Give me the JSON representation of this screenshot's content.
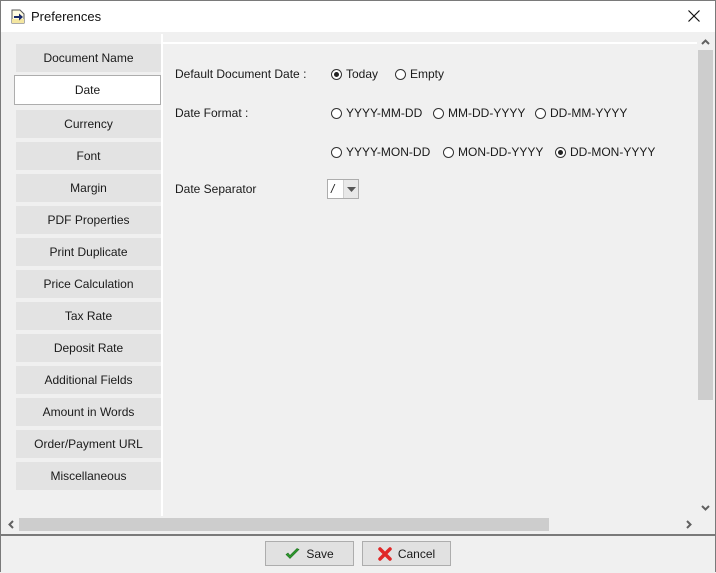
{
  "window": {
    "title": "Preferences",
    "icon": "preferences-app-icon",
    "close_icon": "close-icon"
  },
  "sidebar": {
    "items": [
      {
        "label": "Document Name",
        "active": false
      },
      {
        "label": "Date",
        "active": true
      },
      {
        "label": "Currency",
        "active": false
      },
      {
        "label": "Font",
        "active": false
      },
      {
        "label": "Margin",
        "active": false
      },
      {
        "label": "PDF Properties",
        "active": false
      },
      {
        "label": "Print Duplicate",
        "active": false
      },
      {
        "label": "Price Calculation",
        "active": false
      },
      {
        "label": "Tax Rate",
        "active": false
      },
      {
        "label": "Deposit Rate",
        "active": false
      },
      {
        "label": "Additional Fields",
        "active": false
      },
      {
        "label": "Amount in Words",
        "active": false
      },
      {
        "label": "Order/Payment URL",
        "active": false
      },
      {
        "label": "Miscellaneous",
        "active": false
      }
    ]
  },
  "date_settings": {
    "default_date": {
      "label": "Default Document Date :",
      "options": [
        {
          "label": "Today",
          "checked": true
        },
        {
          "label": "Empty",
          "checked": false
        }
      ]
    },
    "date_format": {
      "label": "Date Format :",
      "options": [
        {
          "label": "YYYY-MM-DD",
          "checked": false
        },
        {
          "label": "MM-DD-YYYY",
          "checked": false
        },
        {
          "label": "DD-MM-YYYY",
          "checked": false
        },
        {
          "label": "YYYY-MON-DD",
          "checked": false
        },
        {
          "label": "MON-DD-YYYY",
          "checked": false
        },
        {
          "label": "DD-MON-YYYY",
          "checked": true
        }
      ]
    },
    "date_separator": {
      "label": "Date Separator",
      "value": "/"
    }
  },
  "footer": {
    "save_label": "Save",
    "cancel_label": "Cancel"
  },
  "colors": {
    "save_check": "#2e9a2e",
    "cancel_x": "#e02828"
  }
}
